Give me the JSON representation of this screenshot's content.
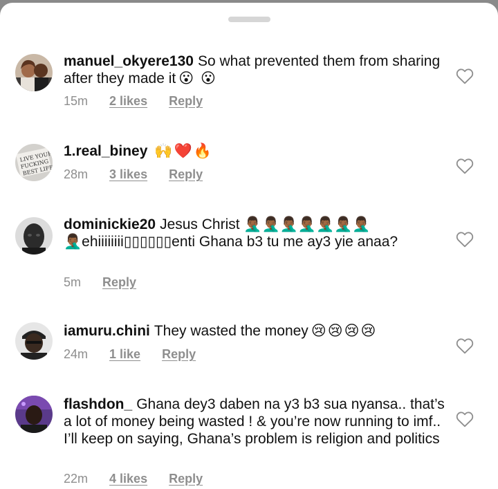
{
  "comments": [
    {
      "username": "manuel_okyere130",
      "text": "So what prevented them from sharing after they made it",
      "emoji": "😮 😮",
      "time": "15m",
      "likes": "2 likes",
      "reply": "Reply",
      "avatar_icon": "couple-photo"
    },
    {
      "username": "1.real_biney",
      "text": "",
      "emoji": "🙌❤️🔥",
      "time": "28m",
      "likes": "3 likes",
      "reply": "Reply",
      "avatar_icon": "live-your-life-sign"
    },
    {
      "username": "dominickie20",
      "text": "Jesus Christ 🤦🏾‍♂️🤦🏾‍♂️🤦🏾‍♂️🤦🏾‍♂️🤦🏾‍♂️🤦🏾‍♂️🤦🏾‍♂️ 🤦🏾‍♂️ehiiiiiiii▯▯▯▯▯▯enti Ghana b3 tu me ay3 yie anaa?",
      "emoji": "",
      "time": "5m",
      "likes": "",
      "reply": "Reply",
      "avatar_icon": "man-portrait"
    },
    {
      "username": "iamuru.chini",
      "text": "They wasted the money",
      "emoji": "😢😢😢😢",
      "time": "24m",
      "likes": "1 like",
      "reply": "Reply",
      "avatar_icon": "man-with-cap"
    },
    {
      "username": "flashdon_",
      "text": "Ghana dey3 daben na y3 b3 sua nyansa.. that’s a lot of money being wasted ! & you’re now running to imf.. I’ll keep on saying, Ghana’s problem is religion and politics",
      "emoji": "",
      "time": "22m",
      "likes": "4 likes",
      "reply": "Reply",
      "avatar_icon": "man-purple-background"
    }
  ]
}
